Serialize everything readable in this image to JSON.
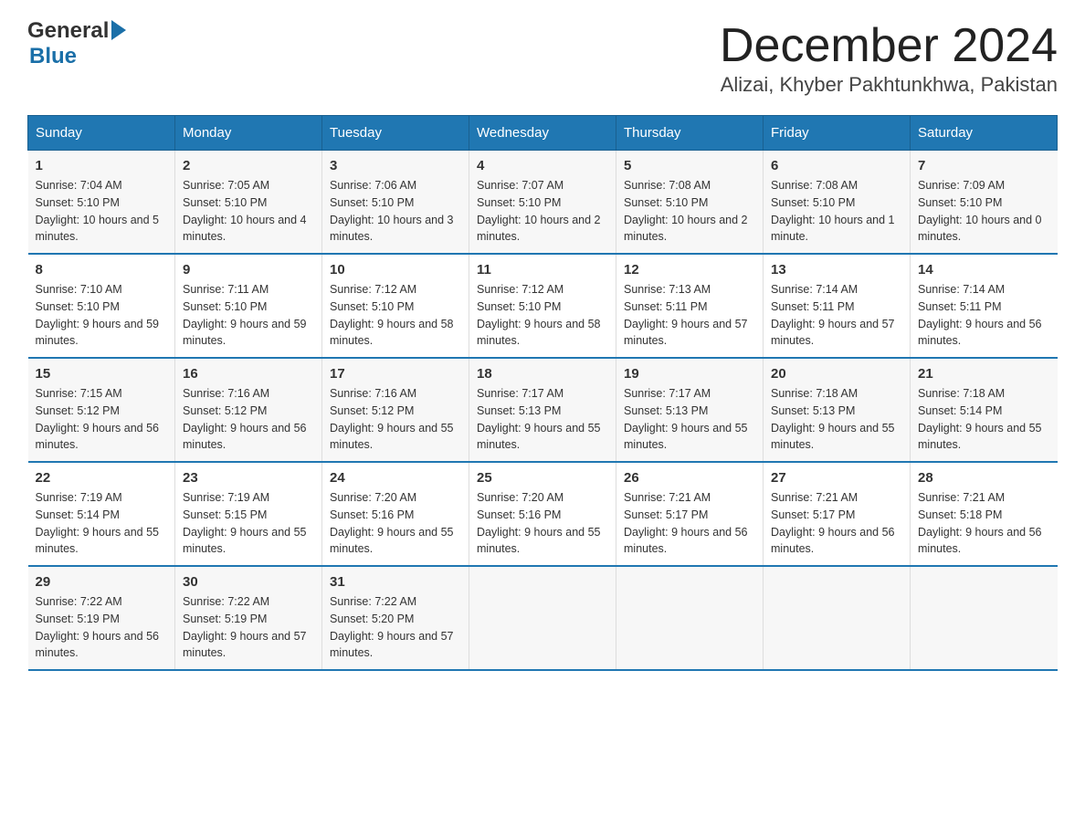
{
  "header": {
    "logo_general": "General",
    "logo_blue": "Blue",
    "month_title": "December 2024",
    "location": "Alizai, Khyber Pakhtunkhwa, Pakistan"
  },
  "weekdays": [
    "Sunday",
    "Monday",
    "Tuesday",
    "Wednesday",
    "Thursday",
    "Friday",
    "Saturday"
  ],
  "weeks": [
    [
      {
        "day": "1",
        "sunrise": "7:04 AM",
        "sunset": "5:10 PM",
        "daylight": "10 hours and 5 minutes."
      },
      {
        "day": "2",
        "sunrise": "7:05 AM",
        "sunset": "5:10 PM",
        "daylight": "10 hours and 4 minutes."
      },
      {
        "day": "3",
        "sunrise": "7:06 AM",
        "sunset": "5:10 PM",
        "daylight": "10 hours and 3 minutes."
      },
      {
        "day": "4",
        "sunrise": "7:07 AM",
        "sunset": "5:10 PM",
        "daylight": "10 hours and 2 minutes."
      },
      {
        "day": "5",
        "sunrise": "7:08 AM",
        "sunset": "5:10 PM",
        "daylight": "10 hours and 2 minutes."
      },
      {
        "day": "6",
        "sunrise": "7:08 AM",
        "sunset": "5:10 PM",
        "daylight": "10 hours and 1 minute."
      },
      {
        "day": "7",
        "sunrise": "7:09 AM",
        "sunset": "5:10 PM",
        "daylight": "10 hours and 0 minutes."
      }
    ],
    [
      {
        "day": "8",
        "sunrise": "7:10 AM",
        "sunset": "5:10 PM",
        "daylight": "9 hours and 59 minutes."
      },
      {
        "day": "9",
        "sunrise": "7:11 AM",
        "sunset": "5:10 PM",
        "daylight": "9 hours and 59 minutes."
      },
      {
        "day": "10",
        "sunrise": "7:12 AM",
        "sunset": "5:10 PM",
        "daylight": "9 hours and 58 minutes."
      },
      {
        "day": "11",
        "sunrise": "7:12 AM",
        "sunset": "5:10 PM",
        "daylight": "9 hours and 58 minutes."
      },
      {
        "day": "12",
        "sunrise": "7:13 AM",
        "sunset": "5:11 PM",
        "daylight": "9 hours and 57 minutes."
      },
      {
        "day": "13",
        "sunrise": "7:14 AM",
        "sunset": "5:11 PM",
        "daylight": "9 hours and 57 minutes."
      },
      {
        "day": "14",
        "sunrise": "7:14 AM",
        "sunset": "5:11 PM",
        "daylight": "9 hours and 56 minutes."
      }
    ],
    [
      {
        "day": "15",
        "sunrise": "7:15 AM",
        "sunset": "5:12 PM",
        "daylight": "9 hours and 56 minutes."
      },
      {
        "day": "16",
        "sunrise": "7:16 AM",
        "sunset": "5:12 PM",
        "daylight": "9 hours and 56 minutes."
      },
      {
        "day": "17",
        "sunrise": "7:16 AM",
        "sunset": "5:12 PM",
        "daylight": "9 hours and 55 minutes."
      },
      {
        "day": "18",
        "sunrise": "7:17 AM",
        "sunset": "5:13 PM",
        "daylight": "9 hours and 55 minutes."
      },
      {
        "day": "19",
        "sunrise": "7:17 AM",
        "sunset": "5:13 PM",
        "daylight": "9 hours and 55 minutes."
      },
      {
        "day": "20",
        "sunrise": "7:18 AM",
        "sunset": "5:13 PM",
        "daylight": "9 hours and 55 minutes."
      },
      {
        "day": "21",
        "sunrise": "7:18 AM",
        "sunset": "5:14 PM",
        "daylight": "9 hours and 55 minutes."
      }
    ],
    [
      {
        "day": "22",
        "sunrise": "7:19 AM",
        "sunset": "5:14 PM",
        "daylight": "9 hours and 55 minutes."
      },
      {
        "day": "23",
        "sunrise": "7:19 AM",
        "sunset": "5:15 PM",
        "daylight": "9 hours and 55 minutes."
      },
      {
        "day": "24",
        "sunrise": "7:20 AM",
        "sunset": "5:16 PM",
        "daylight": "9 hours and 55 minutes."
      },
      {
        "day": "25",
        "sunrise": "7:20 AM",
        "sunset": "5:16 PM",
        "daylight": "9 hours and 55 minutes."
      },
      {
        "day": "26",
        "sunrise": "7:21 AM",
        "sunset": "5:17 PM",
        "daylight": "9 hours and 56 minutes."
      },
      {
        "day": "27",
        "sunrise": "7:21 AM",
        "sunset": "5:17 PM",
        "daylight": "9 hours and 56 minutes."
      },
      {
        "day": "28",
        "sunrise": "7:21 AM",
        "sunset": "5:18 PM",
        "daylight": "9 hours and 56 minutes."
      }
    ],
    [
      {
        "day": "29",
        "sunrise": "7:22 AM",
        "sunset": "5:19 PM",
        "daylight": "9 hours and 56 minutes."
      },
      {
        "day": "30",
        "sunrise": "7:22 AM",
        "sunset": "5:19 PM",
        "daylight": "9 hours and 57 minutes."
      },
      {
        "day": "31",
        "sunrise": "7:22 AM",
        "sunset": "5:20 PM",
        "daylight": "9 hours and 57 minutes."
      },
      null,
      null,
      null,
      null
    ]
  ]
}
